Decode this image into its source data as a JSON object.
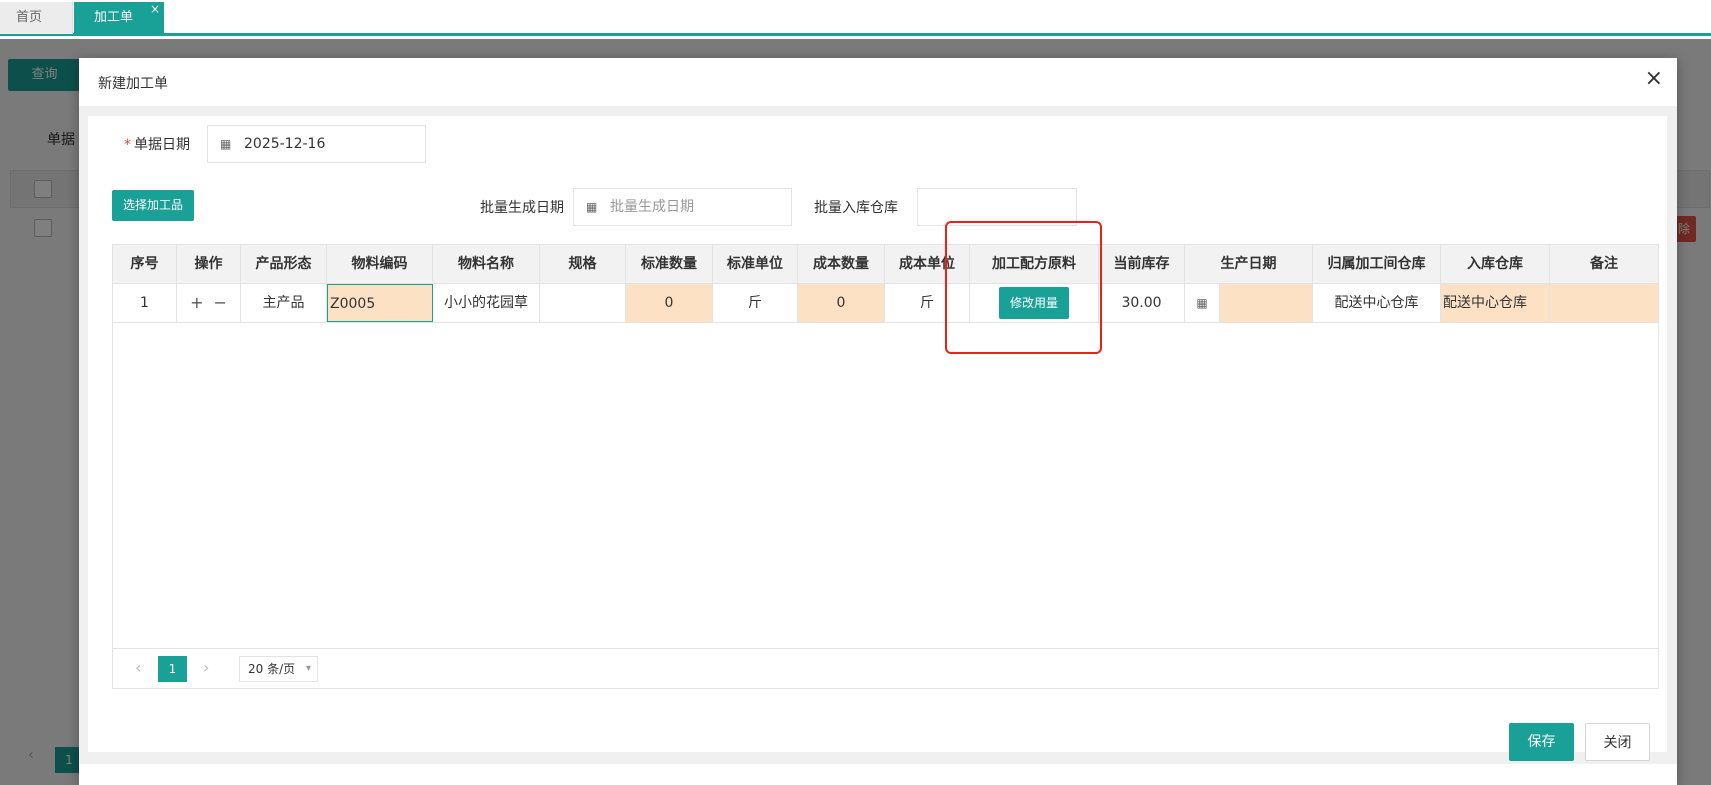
{
  "tabs": {
    "home": "首页",
    "active": "加工单",
    "close": "×"
  },
  "background": {
    "query_button": "查询",
    "doc_label": "单据",
    "delete_fragment": "除",
    "pager_page": "1",
    "pager_prev": "‹"
  },
  "modal": {
    "title": "新建加工单",
    "close": "×",
    "doc_date_label": "单据日期",
    "required": "*",
    "doc_date_value": "2025-12-16",
    "calendar_glyph": "▦",
    "select_button": "选择加工品",
    "batch_date_label": "批量生成日期",
    "batch_date_placeholder": "批量生成日期",
    "batch_warehouse_label": "批量入库仓库",
    "batch_warehouse_value": "",
    "save_button": "保存",
    "close_button": "关闭"
  },
  "table": {
    "headers": [
      "序号",
      "操作",
      "产品形态",
      "物料编码",
      "物料名称",
      "规格",
      "标准数量",
      "标准单位",
      "成本数量",
      "成本单位",
      "加工配方原料",
      "当前库存",
      "生产日期",
      "归属加工间仓库",
      "入库仓库",
      "备注"
    ],
    "row": {
      "index": "1",
      "op_add": "+",
      "op_remove": "−",
      "form": "主产品",
      "code": "Z0005",
      "name": "小小的花园草",
      "spec": "",
      "std_qty": "0",
      "std_unit": "斤",
      "cost_qty": "0",
      "cost_unit": "斤",
      "recipe_button": "修改用量",
      "stock": "30.00",
      "prod_date": "",
      "owner_warehouse": "配送中心仓库",
      "in_warehouse": "配送中心仓库",
      "remark": ""
    }
  },
  "pager": {
    "prev": "‹",
    "next": "›",
    "current": "1",
    "page_size": "20 条/页",
    "caret": "▾"
  },
  "colors": {
    "accent": "#1aa197",
    "editable_cell": "#fde1c4",
    "highlight": "#e5231b"
  }
}
